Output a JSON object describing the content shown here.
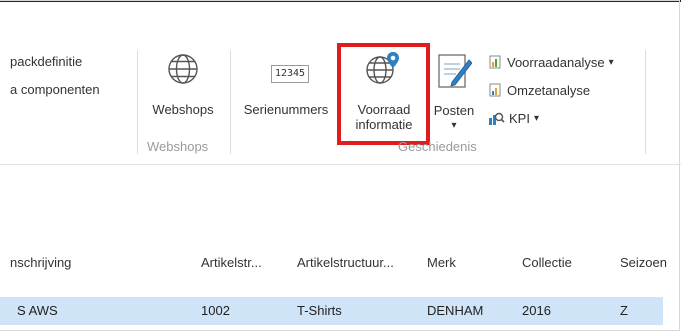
{
  "ribbon": {
    "left_items": [
      "packdefinitie",
      "a componenten"
    ],
    "webshops": {
      "label": "Webshops",
      "group": "Webshops"
    },
    "serienummers": {
      "label": "Serienummers",
      "badge": "12345"
    },
    "voorraad": {
      "line1": "Voorraad",
      "line2": "informatie"
    },
    "posten": {
      "label": "Posten",
      "dropdown": "▾"
    },
    "analysis": [
      {
        "label": "Voorraadanalyse",
        "dropdown": "▾"
      },
      {
        "label": "Omzetanalyse",
        "dropdown": ""
      },
      {
        "label": "KPI",
        "dropdown": "▾"
      }
    ],
    "history_group": "Geschiedenis"
  },
  "table": {
    "columns": [
      "nschrijving",
      "Artikelstr...",
      "Artikelstructuur...",
      "Merk",
      "Collectie",
      "Seizoen"
    ],
    "rows": [
      [
        "S AWS",
        "1002",
        "T-Shirts",
        "DENHAM",
        "2016",
        "Z"
      ]
    ]
  },
  "colors": {
    "highlight": "#e01c1c",
    "selected_row": "#cfe4f6",
    "icon_blue": "#2f7fc1"
  }
}
